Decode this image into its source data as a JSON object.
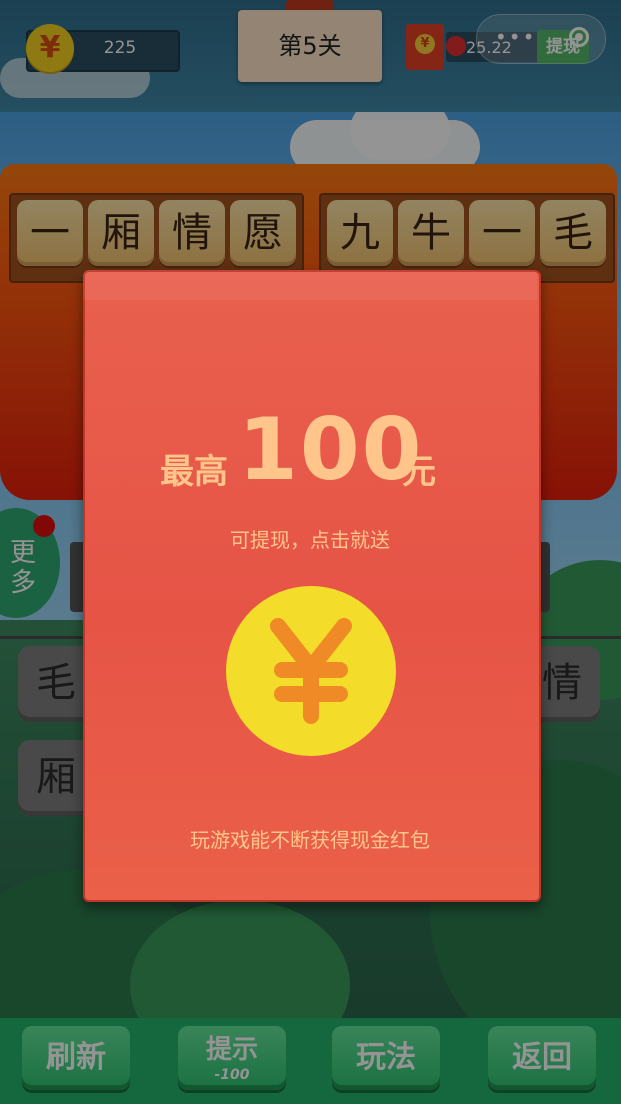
{
  "header": {
    "coin_symbol": "¥",
    "coin_count": "225",
    "level_label": "第5关",
    "redpack_symbol": "¥",
    "cash_amount": "25.22",
    "withdraw_label": "提现",
    "capsule_dots": "•••"
  },
  "board": {
    "left_idiom": [
      "一",
      "厢",
      "情",
      "愿"
    ],
    "right_idiom": [
      "九",
      "牛",
      "一",
      "毛"
    ]
  },
  "side": {
    "more_label": "更多"
  },
  "answer_tiles": [
    "毛",
    "情",
    "厢"
  ],
  "modal": {
    "prefix": "最高",
    "amount": "100",
    "unit": "元",
    "subtitle": "可提现，点击就送",
    "coin_symbol": "¥",
    "footer": "玩游戏能不断获得现金红包"
  },
  "bottom": {
    "refresh": "刷新",
    "hint": "提示",
    "hint_cost": "-100",
    "howto": "玩法",
    "back": "返回"
  },
  "colors": {
    "modal_bg": "#e65446",
    "modal_text": "#ffc58a",
    "coin": "#f3dc2a",
    "button_green": "#2ec271"
  }
}
